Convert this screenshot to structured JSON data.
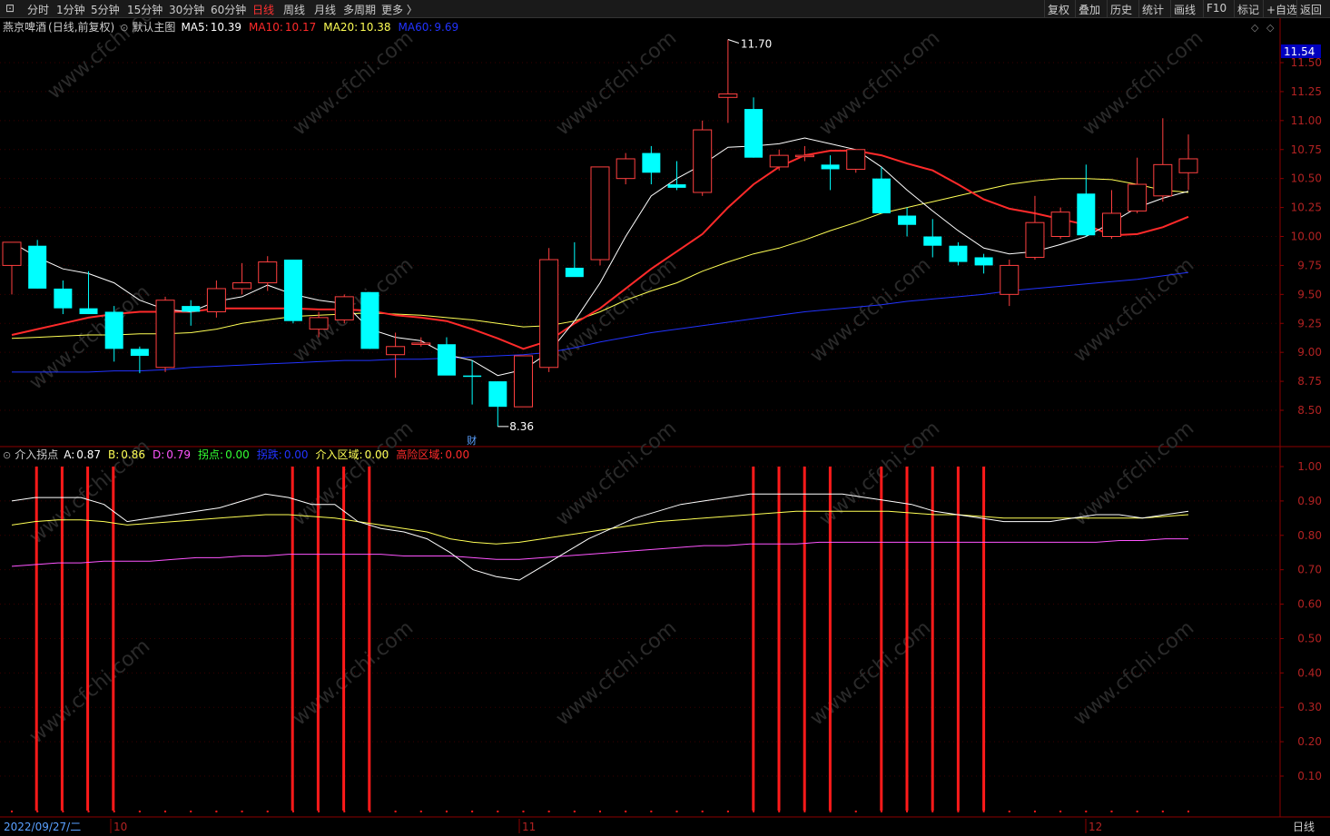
{
  "toolbar": {
    "left": [
      "分时",
      "1分钟",
      "5分钟",
      "15分钟",
      "30分钟",
      "60分钟",
      "日线",
      "周线",
      "月线",
      "多周期",
      "更多 〉"
    ],
    "active": "日线",
    "right": [
      "复权",
      "叠加",
      "历史",
      "统计",
      "画线",
      "F10",
      "标记",
      "+自选",
      "返回"
    ]
  },
  "main": {
    "stock": "燕京啤酒",
    "mode": "(日线,前复权)",
    "template": "默认主图",
    "ma": [
      {
        "label": "MA5:",
        "value": "10.39",
        "color": "#ffffff"
      },
      {
        "label": "MA10:",
        "value": "10.17",
        "color": "#ff2a2a"
      },
      {
        "label": "MA20:",
        "value": "10.38",
        "color": "#ffff55"
      },
      {
        "label": "MA60:",
        "value": "9.69",
        "color": "#2233ff"
      }
    ],
    "high_label": "11.70",
    "low_label": "8.36",
    "cai_label": "财",
    "price_box": "11.54",
    "ticks": [
      "11.50",
      "11.25",
      "11.00",
      "10.75",
      "10.50",
      "10.25",
      "10.00",
      "9.75",
      "9.50",
      "9.25",
      "9.00",
      "8.75",
      "8.50"
    ]
  },
  "indicator": {
    "name": "介入拐点",
    "labels": [
      {
        "label": "A:",
        "value": "0.87",
        "color": "#ffffff"
      },
      {
        "label": "B:",
        "value": "0.86",
        "color": "#ffff55"
      },
      {
        "label": "D:",
        "value": "0.79",
        "color": "#ff55ff"
      },
      {
        "label": "拐点:",
        "value": "0.00",
        "color": "#33ff33"
      },
      {
        "label": "拐跌:",
        "value": "0.00",
        "color": "#2233ff"
      },
      {
        "label": "介入区域:",
        "value": "0.00",
        "color": "#ffff55"
      },
      {
        "label": "高险区域:",
        "value": "0.00",
        "color": "#ff2a2a"
      }
    ],
    "ticks": [
      "1.00",
      "0.90",
      "0.80",
      "0.70",
      "0.60",
      "0.50",
      "0.40",
      "0.30",
      "0.20",
      "0.10"
    ]
  },
  "x_axis": {
    "start": "2022/09/27/二",
    "labels": [
      "10",
      "11",
      "12"
    ],
    "period": "日线"
  },
  "watermark": "www.cfchi.com",
  "colors": {
    "up": "#ff4040",
    "down": "#00ffff",
    "bg": "#000000",
    "axis": "#8b0000"
  },
  "chart_data": [
    {
      "type": "candlestick",
      "y_range": [
        8.3,
        11.72
      ],
      "candles": [
        [
          9.75,
          9.95,
          9.5,
          9.95
        ],
        [
          9.92,
          9.97,
          9.55,
          9.55
        ],
        [
          9.55,
          9.62,
          9.33,
          9.38
        ],
        [
          9.38,
          9.7,
          9.33,
          9.33
        ],
        [
          9.35,
          9.4,
          8.92,
          9.03
        ],
        [
          9.03,
          9.05,
          8.82,
          8.97
        ],
        [
          8.87,
          9.48,
          8.83,
          9.45
        ],
        [
          9.4,
          9.45,
          9.23,
          9.35
        ],
        [
          9.35,
          9.62,
          9.3,
          9.55
        ],
        [
          9.55,
          9.77,
          9.5,
          9.6
        ],
        [
          9.6,
          9.83,
          9.53,
          9.78
        ],
        [
          9.8,
          9.8,
          9.25,
          9.27
        ],
        [
          9.2,
          9.35,
          9.13,
          9.3
        ],
        [
          9.28,
          9.5,
          9.25,
          9.48
        ],
        [
          9.52,
          9.52,
          9.03,
          9.03
        ],
        [
          8.98,
          9.17,
          8.78,
          9.05
        ],
        [
          9.07,
          9.13,
          9.05,
          9.08
        ],
        [
          9.07,
          9.13,
          8.83,
          8.8
        ],
        [
          8.8,
          8.93,
          8.55,
          8.79
        ],
        [
          8.75,
          8.75,
          8.36,
          8.53
        ],
        [
          8.53,
          8.97,
          8.53,
          8.97
        ],
        [
          8.87,
          9.9,
          8.83,
          9.8
        ],
        [
          9.73,
          9.95,
          9.68,
          9.65
        ],
        [
          9.8,
          10.6,
          9.75,
          10.6
        ],
        [
          10.5,
          10.72,
          10.45,
          10.67
        ],
        [
          10.72,
          10.78,
          10.45,
          10.55
        ],
        [
          10.45,
          10.65,
          10.4,
          10.42
        ],
        [
          10.38,
          11.0,
          10.35,
          10.92
        ],
        [
          11.2,
          11.7,
          10.98,
          11.23
        ],
        [
          11.1,
          11.2,
          10.68,
          10.68
        ],
        [
          10.6,
          10.75,
          10.57,
          10.7
        ],
        [
          10.7,
          10.78,
          10.65,
          10.7
        ],
        [
          10.62,
          10.7,
          10.4,
          10.58
        ],
        [
          10.58,
          10.75,
          10.55,
          10.75
        ],
        [
          10.5,
          10.6,
          10.2,
          10.2
        ],
        [
          10.18,
          10.25,
          10.0,
          10.1
        ],
        [
          10.0,
          10.15,
          9.82,
          9.92
        ],
        [
          9.92,
          9.95,
          9.75,
          9.78
        ],
        [
          9.82,
          9.85,
          9.68,
          9.75
        ],
        [
          9.5,
          9.8,
          9.4,
          9.75
        ],
        [
          9.82,
          10.35,
          9.8,
          10.12
        ],
        [
          10.0,
          10.25,
          9.98,
          10.21
        ],
        [
          10.37,
          10.62,
          10.0,
          10.01
        ],
        [
          10.0,
          10.4,
          9.98,
          10.2
        ],
        [
          10.22,
          10.68,
          10.2,
          10.45
        ],
        [
          10.35,
          11.02,
          10.3,
          10.62
        ],
        [
          10.55,
          10.88,
          10.4,
          10.67
        ]
      ],
      "ma5": [
        9.95,
        9.82,
        9.72,
        9.68,
        9.6,
        9.45,
        9.37,
        9.35,
        9.44,
        9.48,
        9.58,
        9.5,
        9.45,
        9.42,
        9.2,
        9.13,
        9.1,
        8.98,
        8.93,
        8.8,
        8.85,
        9.0,
        9.27,
        9.6,
        10.0,
        10.35,
        10.5,
        10.62,
        10.77,
        10.78,
        10.8,
        10.85,
        10.8,
        10.75,
        10.6,
        10.4,
        10.22,
        10.05,
        9.9,
        9.85,
        9.87,
        9.93,
        10.0,
        10.12,
        10.25,
        10.33,
        10.39
      ],
      "ma10": [
        9.15,
        9.2,
        9.25,
        9.3,
        9.33,
        9.35,
        9.35,
        9.35,
        9.38,
        9.38,
        9.38,
        9.38,
        9.37,
        9.37,
        9.36,
        9.32,
        9.3,
        9.27,
        9.2,
        9.12,
        9.03,
        9.1,
        9.25,
        9.38,
        9.55,
        9.72,
        9.87,
        10.02,
        10.25,
        10.45,
        10.6,
        10.7,
        10.74,
        10.74,
        10.7,
        10.63,
        10.57,
        10.45,
        10.32,
        10.24,
        10.2,
        10.15,
        10.1,
        10.01,
        10.02,
        10.08,
        10.17
      ],
      "ma20": [
        9.12,
        9.13,
        9.14,
        9.15,
        9.15,
        9.16,
        9.16,
        9.17,
        9.2,
        9.25,
        9.28,
        9.31,
        9.32,
        9.33,
        9.34,
        9.33,
        9.32,
        9.3,
        9.28,
        9.25,
        9.22,
        9.23,
        9.27,
        9.35,
        9.45,
        9.53,
        9.6,
        9.7,
        9.78,
        9.85,
        9.9,
        9.97,
        10.05,
        10.12,
        10.2,
        10.25,
        10.3,
        10.35,
        10.4,
        10.45,
        10.48,
        10.5,
        10.5,
        10.49,
        10.45,
        10.4,
        10.38
      ],
      "ma60": [
        8.83,
        8.83,
        8.83,
        8.83,
        8.84,
        8.84,
        8.85,
        8.87,
        8.88,
        8.89,
        8.9,
        8.91,
        8.92,
        8.93,
        8.93,
        8.94,
        8.94,
        8.95,
        8.96,
        8.97,
        8.98,
        9.0,
        9.04,
        9.09,
        9.13,
        9.17,
        9.2,
        9.23,
        9.26,
        9.29,
        9.32,
        9.35,
        9.37,
        9.39,
        9.41,
        9.44,
        9.46,
        9.48,
        9.5,
        9.53,
        9.55,
        9.57,
        9.59,
        9.61,
        9.63,
        9.66,
        9.69
      ]
    },
    {
      "type": "line",
      "y_range": [
        0.0,
        1.03
      ],
      "A": [
        0.9,
        0.91,
        0.91,
        0.91,
        0.89,
        0.84,
        0.85,
        0.86,
        0.87,
        0.88,
        0.9,
        0.92,
        0.91,
        0.89,
        0.89,
        0.84,
        0.82,
        0.81,
        0.79,
        0.75,
        0.7,
        0.68,
        0.67,
        0.71,
        0.75,
        0.79,
        0.82,
        0.85,
        0.87,
        0.89,
        0.9,
        0.91,
        0.92,
        0.92,
        0.92,
        0.92,
        0.92,
        0.91,
        0.9,
        0.89,
        0.87,
        0.86,
        0.85,
        0.84,
        0.84,
        0.84,
        0.85,
        0.86,
        0.86,
        0.85,
        0.86,
        0.87
      ],
      "B": [
        0.83,
        0.84,
        0.845,
        0.845,
        0.84,
        0.83,
        0.835,
        0.84,
        0.845,
        0.85,
        0.855,
        0.86,
        0.86,
        0.855,
        0.85,
        0.84,
        0.83,
        0.82,
        0.81,
        0.79,
        0.78,
        0.775,
        0.78,
        0.79,
        0.8,
        0.81,
        0.82,
        0.83,
        0.84,
        0.845,
        0.85,
        0.855,
        0.86,
        0.865,
        0.87,
        0.87,
        0.87,
        0.87,
        0.87,
        0.865,
        0.86,
        0.86,
        0.855,
        0.85,
        0.85,
        0.85,
        0.85,
        0.85,
        0.85,
        0.85,
        0.855,
        0.86
      ],
      "D": [
        0.71,
        0.715,
        0.72,
        0.72,
        0.725,
        0.725,
        0.725,
        0.73,
        0.735,
        0.735,
        0.74,
        0.74,
        0.745,
        0.745,
        0.745,
        0.745,
        0.745,
        0.74,
        0.74,
        0.74,
        0.735,
        0.73,
        0.73,
        0.735,
        0.74,
        0.745,
        0.75,
        0.755,
        0.76,
        0.765,
        0.77,
        0.77,
        0.775,
        0.775,
        0.775,
        0.78,
        0.78,
        0.78,
        0.78,
        0.78,
        0.78,
        0.78,
        0.78,
        0.78,
        0.78,
        0.78,
        0.78,
        0.78,
        0.785,
        0.785,
        0.79,
        0.79
      ],
      "signal_bars_at_candle": [
        1,
        2,
        3,
        4,
        11,
        12,
        13,
        14,
        29,
        30,
        31,
        32,
        34,
        35,
        36,
        37,
        38
      ]
    }
  ]
}
